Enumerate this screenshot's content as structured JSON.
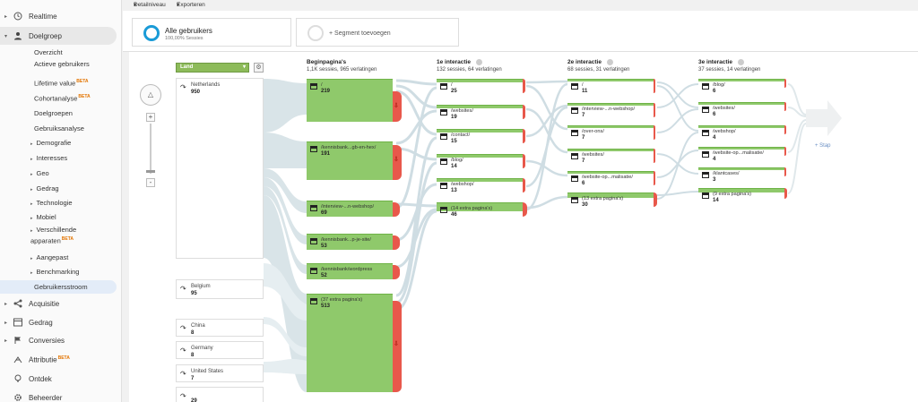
{
  "sidebar": {
    "top": [
      {
        "label": "Realtime"
      },
      {
        "label": "Doelgroep"
      },
      {
        "label": "Acquisitie"
      },
      {
        "label": "Gedrag"
      },
      {
        "label": "Conversies"
      },
      {
        "label": "Attributie",
        "beta": "BETA"
      },
      {
        "label": "Ontdek"
      },
      {
        "label": "Beheerder"
      }
    ],
    "audience_items": [
      {
        "label": "Overzicht"
      },
      {
        "label": "Actieve gebruikers"
      },
      {
        "label": "Lifetime value",
        "beta": "BETA"
      },
      {
        "label": "Cohortanalyse",
        "beta": "BETA"
      },
      {
        "label": "Doelgroepen"
      },
      {
        "label": "Gebruiksanalyse"
      },
      {
        "label": "Demografie"
      },
      {
        "label": "Interesses"
      },
      {
        "label": "Geo"
      },
      {
        "label": "Gedrag"
      },
      {
        "label": "Technologie"
      },
      {
        "label": "Mobiel"
      },
      {
        "label": "Verschillende apparaten",
        "beta": "BETA"
      },
      {
        "label": "Aangepast"
      },
      {
        "label": "Benchmarking"
      },
      {
        "label": "Gebruikersstroom"
      }
    ]
  },
  "toolbar": {
    "detail": "Detailniveau",
    "export": "Exporteren"
  },
  "segments": {
    "active_title": "Alle gebruikers",
    "active_sub": "100,00% Sessies",
    "add_label": "+ Segment toevoegen"
  },
  "flow": {
    "dimension": "Land",
    "next_step": "+ Stap",
    "countries": [
      {
        "name": "Netherlands",
        "value": "950"
      },
      {
        "name": "Belgium",
        "value": "95"
      },
      {
        "name": "China",
        "value": "8"
      },
      {
        "name": "Germany",
        "value": "8"
      },
      {
        "name": "United States",
        "value": "7"
      },
      {
        "name": "",
        "value": "29"
      }
    ],
    "columns": [
      {
        "title": "Beginpagina's",
        "info": false,
        "sub": "1,1K sessies, 965 verlatingen",
        "nodes": [
          {
            "name": "/",
            "value": "219"
          },
          {
            "name": "/kennisbank...gb-en-hex/",
            "value": "191"
          },
          {
            "name": "/interview-...n-webshop/",
            "value": "69"
          },
          {
            "name": "/kennisbank...p-je-site/",
            "value": "53"
          },
          {
            "name": "/kennisbank/wordpress",
            "value": "52"
          },
          {
            "name": "(37 extra pagina's)",
            "value": "513"
          }
        ]
      },
      {
        "title": "1e interactie",
        "info": true,
        "sub": "132 sessies, 64 verlatingen",
        "nodes": [
          {
            "name": "/",
            "value": "25"
          },
          {
            "name": "/websites/",
            "value": "19"
          },
          {
            "name": "/contact/",
            "value": "15"
          },
          {
            "name": "/blog/",
            "value": "14"
          },
          {
            "name": "/webshop/",
            "value": "13"
          },
          {
            "name": "(14 extra pagina's)",
            "value": "46"
          }
        ]
      },
      {
        "title": "2e interactie",
        "info": true,
        "sub": "68 sessies, 31 verlatingen",
        "nodes": [
          {
            "name": "/",
            "value": "11"
          },
          {
            "name": "/interview-...n-webshop/",
            "value": "7"
          },
          {
            "name": "/over-ons/",
            "value": "7"
          },
          {
            "name": "/websites/",
            "value": "7"
          },
          {
            "name": "/website-op...malisatie/",
            "value": "6"
          },
          {
            "name": "(13 extra pagina's)",
            "value": "30"
          }
        ]
      },
      {
        "title": "3e interactie",
        "info": true,
        "sub": "37 sessies, 14 verlatingen",
        "nodes": [
          {
            "name": "/blog/",
            "value": "6"
          },
          {
            "name": "/websites/",
            "value": "6"
          },
          {
            "name": "/webshop/",
            "value": "4"
          },
          {
            "name": "/website-op...malisatie/",
            "value": "4"
          },
          {
            "name": "/klantcases/",
            "value": "3"
          },
          {
            "name": "(9 extra pagina's)",
            "value": "14"
          }
        ]
      }
    ]
  },
  "colors": {
    "accent": "#1a73e8",
    "node": "#8fc96b",
    "dropoff": "#e8584b",
    "flow": "#cfdde3"
  }
}
